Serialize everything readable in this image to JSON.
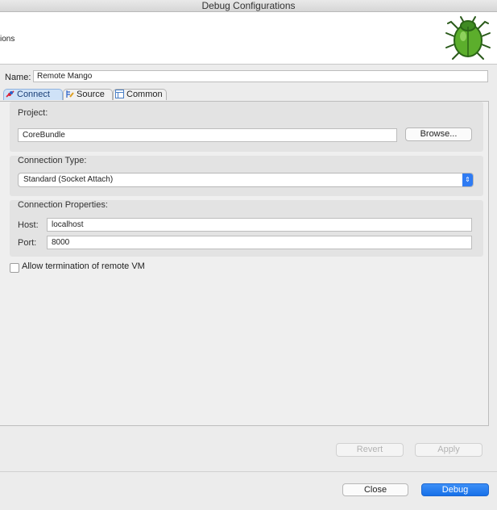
{
  "window": {
    "title": "Debug Configurations"
  },
  "header": {
    "subtitle_fragment": "ions",
    "logo_icon": "bug-icon"
  },
  "name_row": {
    "label": "Name:",
    "value": "Remote Mango"
  },
  "tabs": [
    {
      "label": "Connect",
      "icon": "connect-icon",
      "active": true
    },
    {
      "label": "Source",
      "icon": "source-icon",
      "active": false
    },
    {
      "label": "Common",
      "icon": "common-icon",
      "active": false
    }
  ],
  "project": {
    "label": "Project:",
    "value": "CoreBundle",
    "browse_label": "Browse..."
  },
  "connection_type": {
    "label": "Connection Type:",
    "selected": "Standard (Socket Attach)"
  },
  "connection_properties": {
    "label": "Connection Properties:",
    "host_label": "Host:",
    "host_value": "localhost",
    "port_label": "Port:",
    "port_value": "8000"
  },
  "allow_termination": {
    "label": "Allow termination of remote VM",
    "checked": false
  },
  "footer": {
    "revert_label": "Revert",
    "apply_label": "Apply",
    "close_label": "Close",
    "debug_label": "Debug"
  },
  "colors": {
    "accent": "#1670e9",
    "active_tab": "#cfe2f7"
  }
}
